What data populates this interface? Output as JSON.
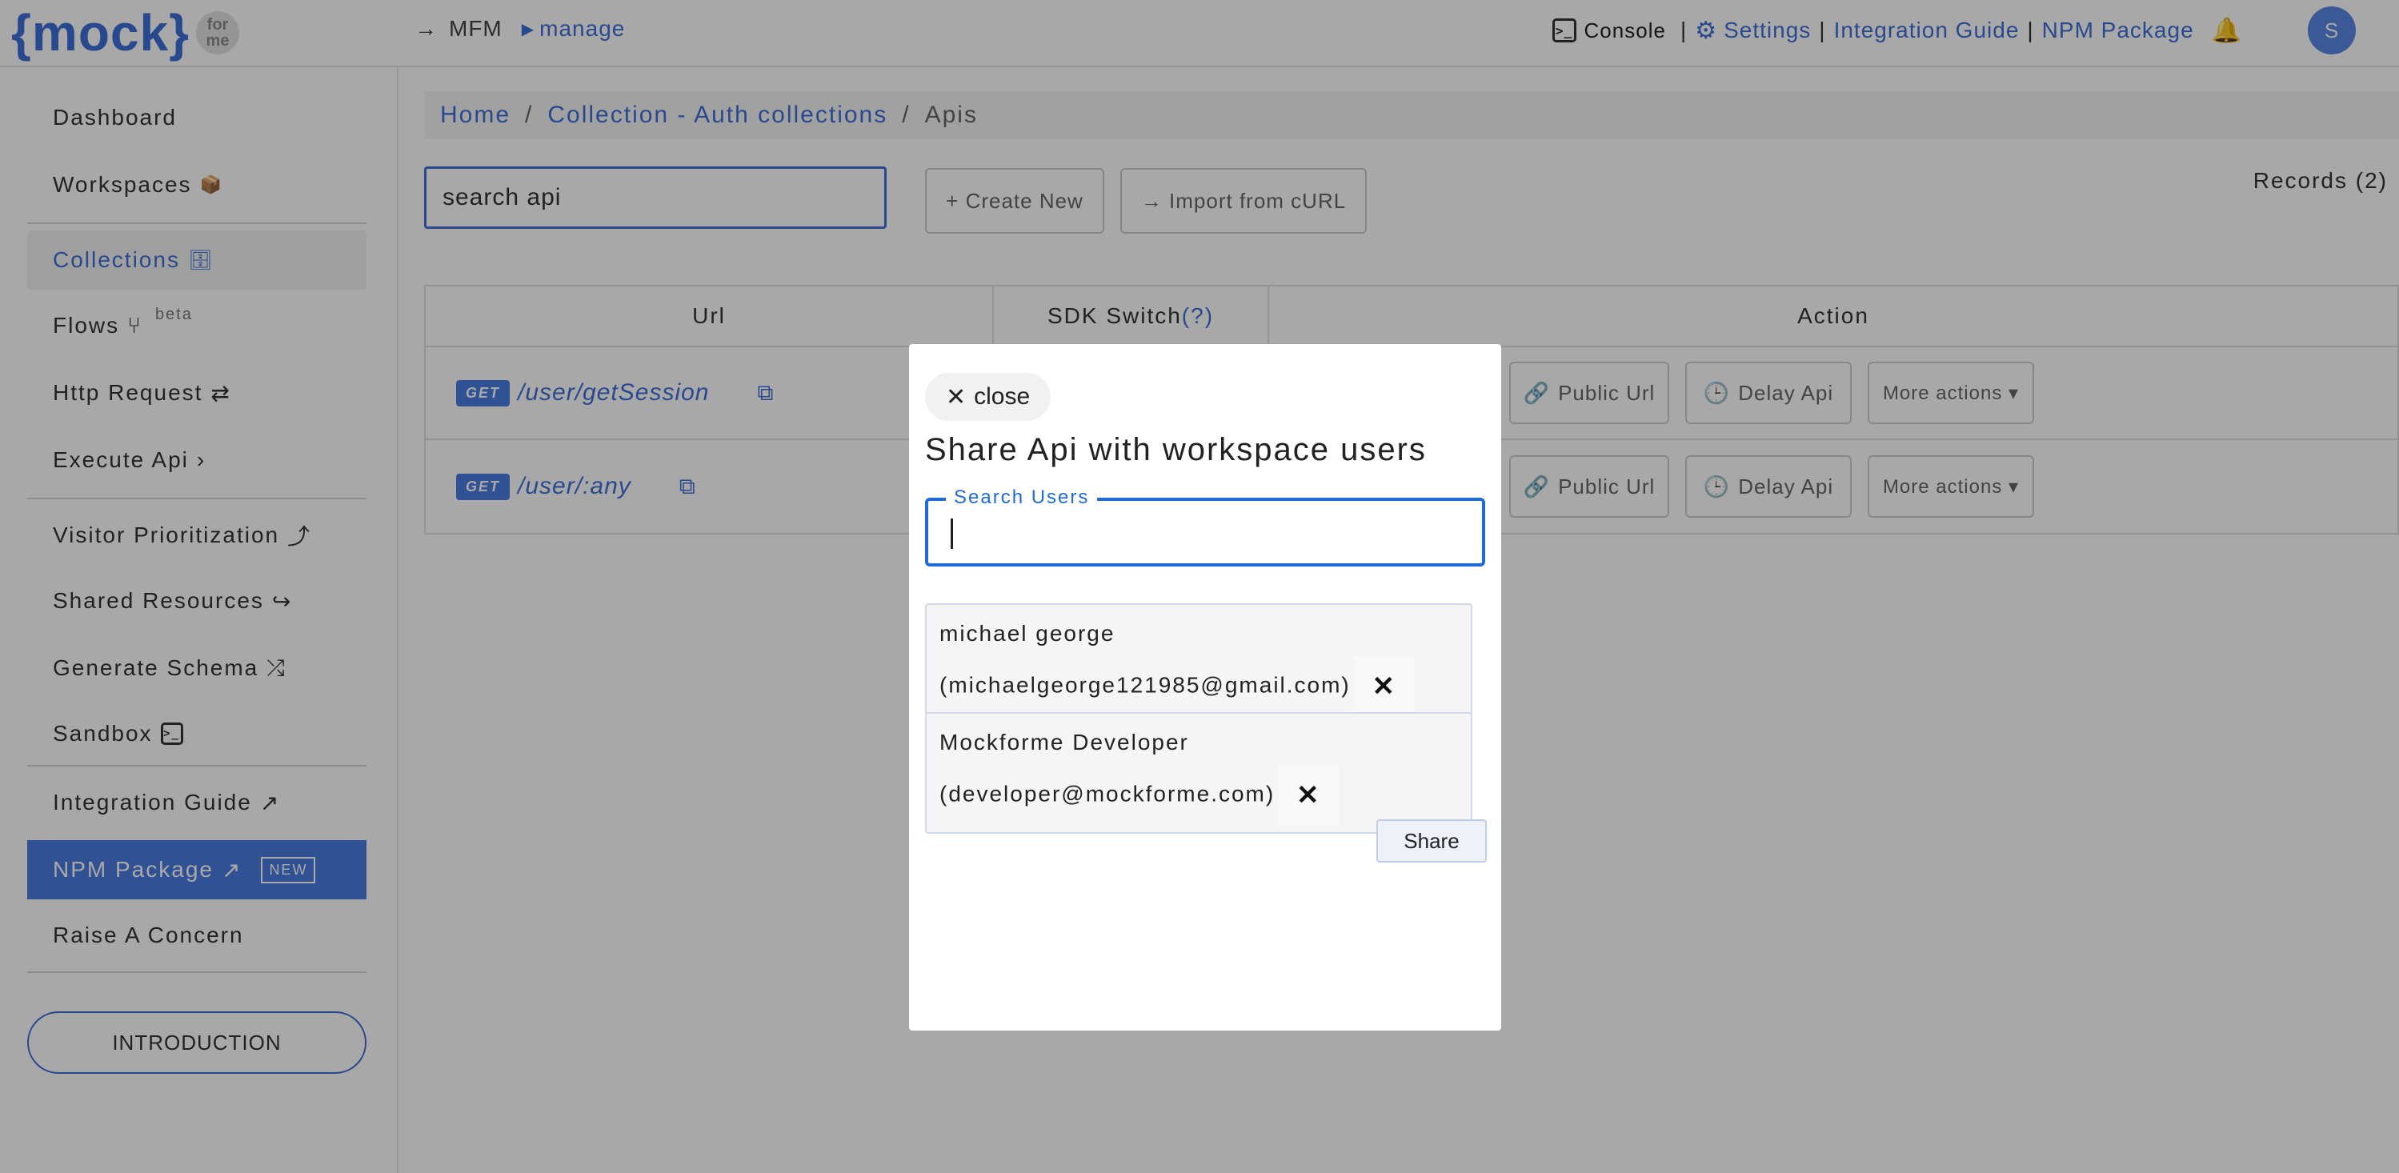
{
  "header": {
    "logo_text": "{mock}",
    "logo_badge_line1": "for",
    "logo_badge_line2": "me",
    "arrow": "→",
    "app_short": "MFM",
    "section": "manage",
    "console_label": "Console",
    "console_icon": ">_",
    "separator": "|",
    "settings_label": "Settings",
    "integration_label": "Integration Guide",
    "npm_label": "NPM Package",
    "avatar_letter": "S"
  },
  "sidebar": {
    "items": [
      {
        "label": "Dashboard"
      },
      {
        "label": "Workspaces",
        "icon": "📦"
      },
      {
        "label": "Collections",
        "icon": "🗄"
      },
      {
        "label": "Flows",
        "icon": "⑂",
        "tag": "beta"
      },
      {
        "label": "Http Request",
        "icon": "⇄"
      },
      {
        "label": "Execute Api",
        "icon": "›"
      },
      {
        "label": "Visitor Prioritization",
        "icon": "⤴"
      },
      {
        "label": "Shared Resources",
        "icon": "↪"
      },
      {
        "label": "Generate Schema",
        "icon": "⤮"
      },
      {
        "label": "Sandbox",
        "icon": ">_"
      },
      {
        "label": "Integration Guide",
        "icon": "↗"
      },
      {
        "label": "NPM Package",
        "icon": "↗",
        "badge": "NEW"
      },
      {
        "label": "Raise A Concern"
      }
    ],
    "intro_button": "INTRODUCTION"
  },
  "breadcrumb": {
    "home": "Home",
    "separator": "/",
    "collection": "Collection - Auth collections",
    "current": "Apis"
  },
  "toolbar": {
    "search_value": "search api",
    "create_new": "+ Create New",
    "import_curl": "→ Import from cURL",
    "records": "Records (2)"
  },
  "table": {
    "headers": {
      "url": "Url",
      "sdk": "SDK Switch",
      "sdk_help": "(?)",
      "action": "Action"
    },
    "rows": [
      {
        "method": "GET",
        "path": "/user/getSession"
      },
      {
        "method": "GET",
        "path": "/user/:any"
      }
    ],
    "actions": {
      "public_url": "Public Url",
      "delay_api": "Delay Api",
      "more": "More actions ▾"
    }
  },
  "modal": {
    "close_label": "close",
    "title": "Share Api with workspace users",
    "search_label": "Search Users",
    "search_value": "",
    "users": [
      {
        "name": "michael george",
        "email": "(michaelgeorge121985@gmail.com)"
      },
      {
        "name": "Mockforme Developer",
        "email": "(developer@mockforme.com)"
      }
    ],
    "share_label": "Share"
  },
  "colors": {
    "accent": "#3f6fd8",
    "active_nav": "#4a7ce0",
    "focus_blue": "#1f6bd6",
    "overlay": "rgba(0,0,0,0.34)"
  }
}
